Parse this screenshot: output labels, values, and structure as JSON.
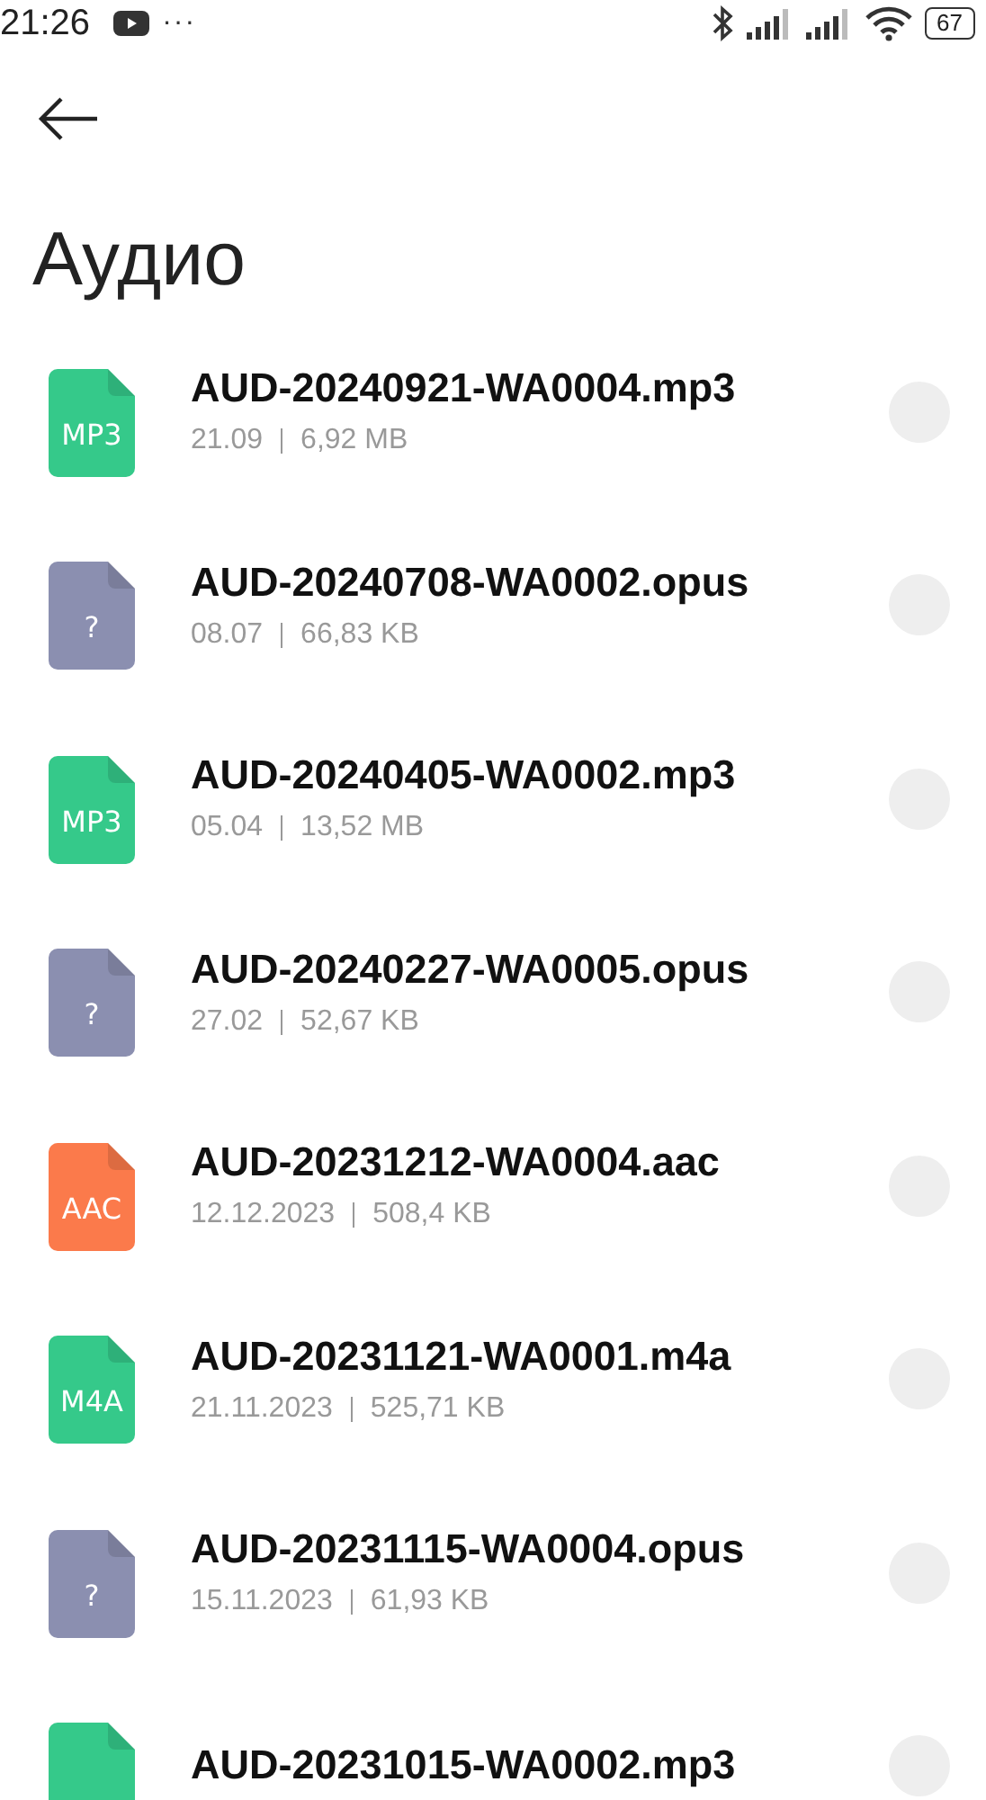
{
  "status_bar": {
    "time": "21:26",
    "more": "···",
    "battery": "67"
  },
  "title": "Аудио",
  "files": [
    {
      "icon_label": "MP3",
      "color": "#35c98a",
      "name": "AUD-20240921-WA0004.mp3",
      "date": "21.09",
      "size": "6,92 MB",
      "selected": false
    },
    {
      "icon_label": "?",
      "color": "#8b8fb0",
      "name": "AUD-20240708-WA0002.opus",
      "date": "08.07",
      "size": "66,83 KB",
      "selected": false
    },
    {
      "icon_label": "MP3",
      "color": "#35c98a",
      "name": "AUD-20240405-WA0002.mp3",
      "date": "05.04",
      "size": "13,52 MB",
      "selected": false
    },
    {
      "icon_label": "?",
      "color": "#8b8fb0",
      "name": "AUD-20240227-WA0005.opus",
      "date": "27.02",
      "size": "52,67 KB",
      "selected": false
    },
    {
      "icon_label": "AAC",
      "color": "#fb7a4b",
      "name": "AUD-20231212-WA0004.aac",
      "date": "12.12.2023",
      "size": "508,4 KB",
      "selected": false
    },
    {
      "icon_label": "M4A",
      "color": "#35c98a",
      "name": "AUD-20231121-WA0001.m4a",
      "date": "21.11.2023",
      "size": "525,71 KB",
      "selected": false
    },
    {
      "icon_label": "?",
      "color": "#8b8fb0",
      "name": "AUD-20231115-WA0004.opus",
      "date": "15.11.2023",
      "size": "61,93 KB",
      "selected": false
    },
    {
      "color": "#35c98a",
      "name": "AUD-20231015-WA0002.mp3",
      "selected": false
    }
  ]
}
